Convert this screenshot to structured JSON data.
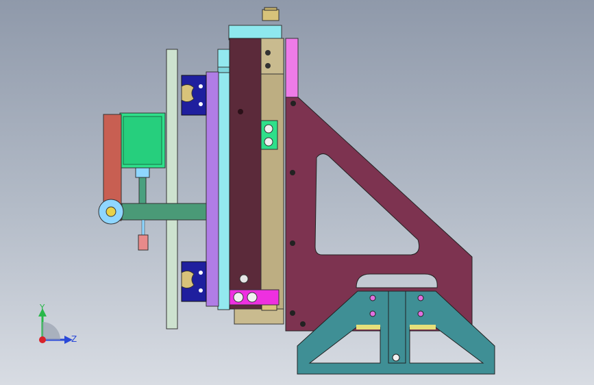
{
  "viewport": {
    "background_top": "#8f99aa",
    "background_bottom": "#d8dce3"
  },
  "model": {
    "parts": [
      {
        "name": "pneumatic-fitting",
        "color": "#d8c37a"
      },
      {
        "name": "top-cap-block",
        "color": "#8ee8ee"
      },
      {
        "name": "main-slide-plate",
        "color": "#5b2a3a"
      },
      {
        "name": "guide-rail",
        "color": "#bdae82"
      },
      {
        "name": "pink-side-strip",
        "color": "#ee7be8"
      },
      {
        "name": "triangular-bracket",
        "color": "#7d3350"
      },
      {
        "name": "teal-base-mount",
        "color": "#3f8f95"
      },
      {
        "name": "cyan-backplate",
        "color": "#93e8ef"
      },
      {
        "name": "purple-plate",
        "color": "#b07de6"
      },
      {
        "name": "linear-guide-carriage",
        "color": "#1f1f9e"
      },
      {
        "name": "light-green-plate",
        "color": "#cde2cf"
      },
      {
        "name": "green-motor-block",
        "color": "#2ee08a"
      },
      {
        "name": "red-arm",
        "color": "#c85f52"
      },
      {
        "name": "green-connector-bar",
        "color": "#4a9a77"
      },
      {
        "name": "magenta-clamp",
        "color": "#ee30e0"
      }
    ]
  },
  "triad": {
    "y_label": "Y",
    "z_label": "Z",
    "y_color": "#29b84a",
    "z_color": "#2a49d8",
    "origin_color": "#d8232a"
  }
}
